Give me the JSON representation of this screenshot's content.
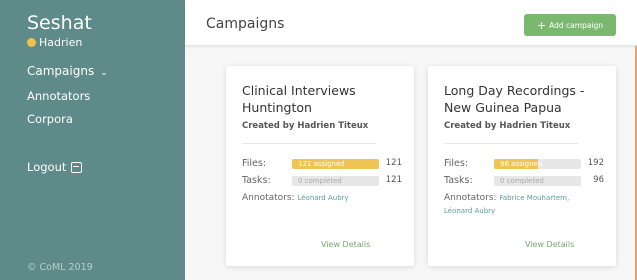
{
  "sidebar": {
    "brand": "Seshat",
    "user": "Hadrien",
    "nav": {
      "campaigns": "Campaigns",
      "annotators": "Annotators",
      "corpora": "Corpora",
      "logout": "Logout"
    },
    "copyright": "© CoML 2019",
    "user_dot_color": "#f0c24a"
  },
  "header": {
    "title": "Campaigns",
    "add_button": "Add campaign"
  },
  "campaigns": [
    {
      "title": "Clinical Interviews Huntington",
      "created_by": "Created by Hadrien Titeux",
      "files_label": "Files:",
      "files_bar_text": "121 assigned",
      "files_assigned": 121,
      "files_total": "121",
      "tasks_label": "Tasks:",
      "tasks_bar_text": "0 completed",
      "tasks_completed": 0,
      "tasks_total": "121",
      "annotators_label": "Annotators:",
      "annotators": "Léonard Aubry",
      "view_details": "View Details"
    },
    {
      "title": "Long Day Recordings - New Guinea Papua",
      "created_by": "Created by Hadrien Titeux",
      "files_label": "Files:",
      "files_bar_text": "96 assigned",
      "files_assigned": 96,
      "files_total": "192",
      "tasks_label": "Tasks:",
      "tasks_bar_text": "0 completed",
      "tasks_completed": 0,
      "tasks_total": "96",
      "annotators_label": "Annotators:",
      "annotators": "Fabrice Mouhartem, Léonard Aubry",
      "view_details": "View Details"
    }
  ],
  "colors": {
    "sidebar": "#5e8a8a",
    "accent_green": "#7bb86f",
    "progress_fill": "#efc454"
  }
}
